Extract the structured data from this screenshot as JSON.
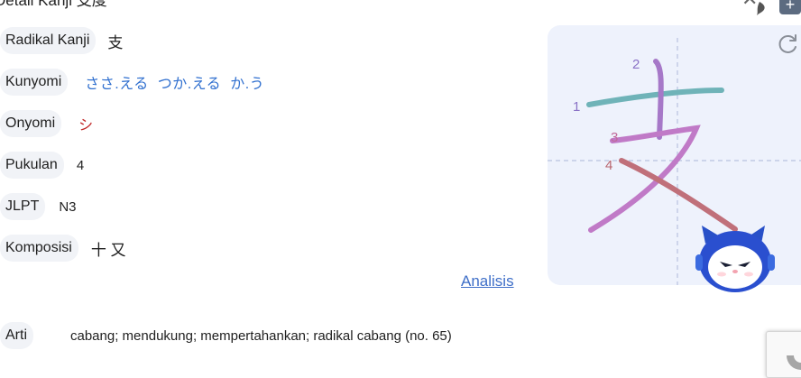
{
  "header": {
    "title": "Detail Kanji 支度",
    "close_glyph": "✕",
    "plus_glyph": "+"
  },
  "fields": {
    "radical": {
      "label": "Radikal Kanji",
      "value": "支"
    },
    "kunyomi": {
      "label": "Kunyomi",
      "readings": [
        "ささ.える",
        "つか.える",
        "か.う"
      ]
    },
    "onyomi": {
      "label": "Onyomi",
      "value": "シ"
    },
    "strokes": {
      "label": "Pukulan",
      "value": "4"
    },
    "jlpt": {
      "label": "JLPT",
      "value": "N3"
    },
    "composition": {
      "label": "Komposisi",
      "value": "十 又"
    },
    "meaning": {
      "label": "Arti",
      "value": "cabang; mendukung; mempertahankan; radikal cabang (no. 65)"
    }
  },
  "analysis_link": "Analisis",
  "stroke_order": {
    "numbers": [
      "1",
      "2",
      "3",
      "4"
    ],
    "colors": {
      "s1": "#6fb3b8",
      "s2": "#a678c8",
      "s3": "#c07ac7",
      "s4": "#c0707a"
    }
  },
  "icons": {
    "refresh": "refresh-icon",
    "mascot": "robot-cat-mascot",
    "recaptcha": "recaptcha-badge-icon"
  }
}
